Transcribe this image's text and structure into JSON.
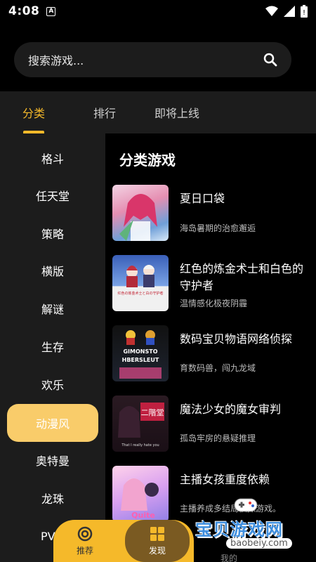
{
  "status": {
    "time": "4:08",
    "a_icon": "A"
  },
  "search": {
    "placeholder": "搜索游戏..."
  },
  "tabs": [
    {
      "label": "分类",
      "active": true
    },
    {
      "label": "排行",
      "active": false
    },
    {
      "label": "即将上线",
      "active": false
    }
  ],
  "sidebar": {
    "items": [
      {
        "label": "格斗"
      },
      {
        "label": "任天堂"
      },
      {
        "label": "策略"
      },
      {
        "label": "横版"
      },
      {
        "label": "解谜"
      },
      {
        "label": "生存"
      },
      {
        "label": "欢乐"
      },
      {
        "label": "动漫风",
        "active": true
      },
      {
        "label": "奥特曼"
      },
      {
        "label": "龙珠"
      },
      {
        "label": "PV"
      }
    ]
  },
  "content": {
    "title": "分类游戏",
    "games": [
      {
        "title": "夏日口袋",
        "desc": "海岛暑期的治愈邂逅"
      },
      {
        "title": "红色的炼金术士和白色的守护者",
        "desc": "温情感化极夜阴霾",
        "thumb_text": "红色の炼金术士と白の守护者"
      },
      {
        "title": "数码宝贝物语网络侦探",
        "desc": "育数码兽，闯九龙域",
        "thumb_text": "GIMONSTO HBERSLEUT"
      },
      {
        "title": "魔法少女的魔女审判",
        "desc": "孤岛牢房的悬疑推理",
        "thumb_text": "二階堂 Thai I really hate you"
      },
      {
        "title": "主播女孩重度依赖",
        "desc": "主播养成多结局模拟游戏。",
        "thumb_text": "Quite"
      }
    ]
  },
  "bottom_nav": {
    "recommend": "推荐",
    "discover": "发现",
    "mine": "我的"
  },
  "watermark": {
    "main": "宝贝游戏网",
    "url": "baobeiy.com"
  },
  "colors": {
    "accent": "#f5b92a",
    "sidebar_active": "#f9cc6a",
    "panel": "#1c1c1c"
  }
}
